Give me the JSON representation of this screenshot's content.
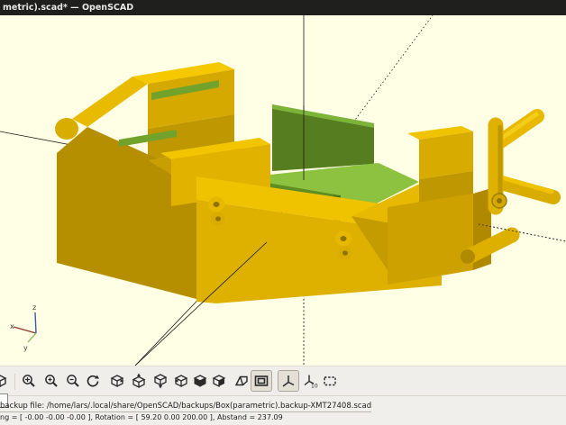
{
  "window": {
    "title": "metric).scad* — OpenSCAD"
  },
  "viewport": {
    "background_color": "#FFFFE5",
    "model": {
      "description": "yellow parametric box 3D model with green PCB panels",
      "yellow": "#E0B200",
      "yellow_bright": "#F2C500",
      "yellow_dark": "#B68F00",
      "green_dark": "#567D20",
      "green_light": "#8CC23F"
    },
    "axis_gizmo": {
      "x_label": "x",
      "y_label": "y",
      "z_label": "z"
    }
  },
  "toolbar": {
    "buttons": [
      {
        "name": "view-partial",
        "pressed": false
      },
      {
        "name": "zoom-all",
        "pressed": false
      },
      {
        "name": "zoom-in",
        "pressed": false
      },
      {
        "name": "zoom-out",
        "pressed": false
      },
      {
        "name": "reset-view",
        "pressed": false
      },
      {
        "name": "view-right",
        "pressed": false
      },
      {
        "name": "view-top",
        "pressed": false
      },
      {
        "name": "view-bottom",
        "pressed": false
      },
      {
        "name": "view-left",
        "pressed": false
      },
      {
        "name": "view-front",
        "pressed": false
      },
      {
        "name": "view-back",
        "pressed": false
      },
      {
        "name": "view-diagonal",
        "pressed": false
      },
      {
        "name": "view-orthogonal",
        "pressed": true
      },
      {
        "name": "show-axes",
        "pressed": true
      },
      {
        "name": "show-scale-markers",
        "pressed": false
      },
      {
        "name": "show-crosshairs",
        "pressed": false
      }
    ]
  },
  "statusbar": {
    "backup_line": "backup file: /home/lars/.local/share/OpenSCAD/backups/Box(parametric).backup-XMT27408.scad",
    "viewport_line": "ng = [ -0.00 -0.00 -0.00 ], Rotation = [ 59.20 0.00 200.00 ], Abstand = 237.09"
  }
}
